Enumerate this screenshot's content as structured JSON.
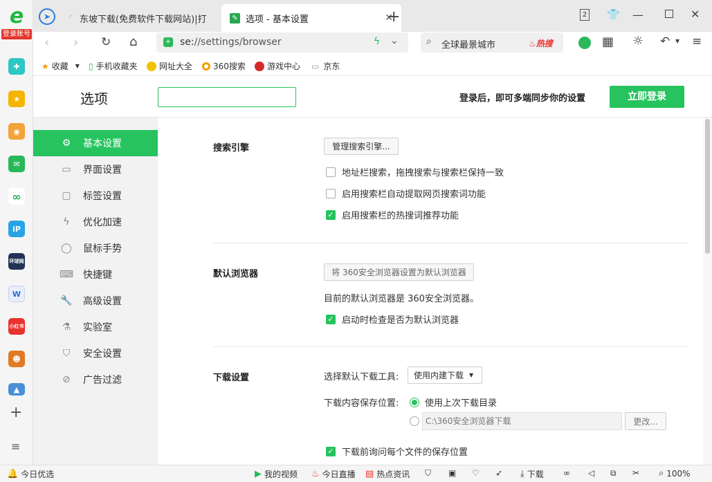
{
  "sidebar": {
    "login_badge": "登录账号",
    "items": [
      {
        "icon": "medical-cross-icon",
        "color": "#2dc7c4"
      },
      {
        "icon": "star-icon",
        "color": "#f5b400"
      },
      {
        "icon": "weibo-icon",
        "color": "#f2a33a"
      },
      {
        "icon": "mail-icon",
        "color": "#28b85a"
      },
      {
        "icon": "cloud-link-icon",
        "color": "#2cb25a"
      },
      {
        "icon": "ip-icon",
        "color": "#2aa3e6",
        "label": "iP"
      },
      {
        "icon": "news-icon",
        "color": "#223355",
        "label": "环球网"
      },
      {
        "icon": "document-icon",
        "color": "#2b6fd6"
      },
      {
        "icon": "redbook-icon",
        "color": "#e8322e",
        "label": "小红书"
      },
      {
        "icon": "game-icon",
        "color": "#e07b25"
      },
      {
        "icon": "landscape-icon",
        "color": "#4a8fd6"
      }
    ]
  },
  "tabs": [
    {
      "title": "东坡下载(免费软件下载网站)|打"
    },
    {
      "title": "选项 - 基本设置"
    }
  ],
  "window": {
    "tab_count": "2"
  },
  "address": {
    "url_prefix": "se:",
    "url_rest": "//settings/browser",
    "search_text": "全球最景城市",
    "hot_label": "热搜"
  },
  "bookmarks": [
    {
      "label": "收藏",
      "icon": "star-icon"
    },
    {
      "label": "手机收藏夹",
      "icon": "phone-icon"
    },
    {
      "label": "网址大全",
      "icon": "web-directory-icon"
    },
    {
      "label": "360搜索",
      "icon": "360-search-icon"
    },
    {
      "label": "游戏中心",
      "icon": "game-center-icon"
    },
    {
      "label": "京东",
      "icon": "page-icon"
    }
  ],
  "header": {
    "title": "选项",
    "search_value": "",
    "sync_text": "登录后，即可多端同步你的设置",
    "login_button": "立即登录"
  },
  "nav": [
    {
      "label": "基本设置",
      "icon": "gear-icon",
      "active": true
    },
    {
      "label": "界面设置",
      "icon": "window-icon"
    },
    {
      "label": "标签设置",
      "icon": "tab-icon"
    },
    {
      "label": "优化加速",
      "icon": "lightning-icon"
    },
    {
      "label": "鼠标手势",
      "icon": "mouse-icon"
    },
    {
      "label": "快捷键",
      "icon": "keyboard-icon"
    },
    {
      "label": "高级设置",
      "icon": "wrench-icon"
    },
    {
      "label": "实验室",
      "icon": "flask-icon"
    },
    {
      "label": "安全设置",
      "icon": "shield-icon"
    },
    {
      "label": "广告过滤",
      "icon": "block-icon"
    }
  ],
  "search_engine": {
    "title": "搜索引擎",
    "manage_button": "管理搜索引擎...",
    "options": [
      {
        "label": "地址栏搜索，拖拽搜索与搜索栏保持一致",
        "checked": false
      },
      {
        "label": "启用搜索栏自动提取网页搜索词功能",
        "checked": false
      },
      {
        "label": "启用搜索栏的热搜词推荐功能",
        "checked": true
      }
    ]
  },
  "default_browser": {
    "title": "默认浏览器",
    "set_button": "将 360安全浏览器设置为默认浏览器",
    "status_text": "目前的默认浏览器是 360安全浏览器。",
    "check_option": {
      "label": "启动时检查是否为默认浏览器",
      "checked": true
    }
  },
  "download": {
    "title": "下载设置",
    "tool_label": "选择默认下载工具:",
    "tool_value": "使用内建下载",
    "location_label": "下载内容保存位置:",
    "radio_last": "使用上次下载目录",
    "path_value": "C:\\360安全浏览器下载",
    "change_button": "更改...",
    "ask_option": {
      "label": "下载前询问每个文件的保存位置",
      "checked": true
    }
  },
  "statusbar": {
    "left": "今日优选",
    "video": "我的视频",
    "live": "今日直播",
    "news": "热点资讯",
    "download": "下载",
    "zoom": "100%"
  },
  "colors": {
    "accent": "#26c35e",
    "hot": "#e8322e"
  }
}
